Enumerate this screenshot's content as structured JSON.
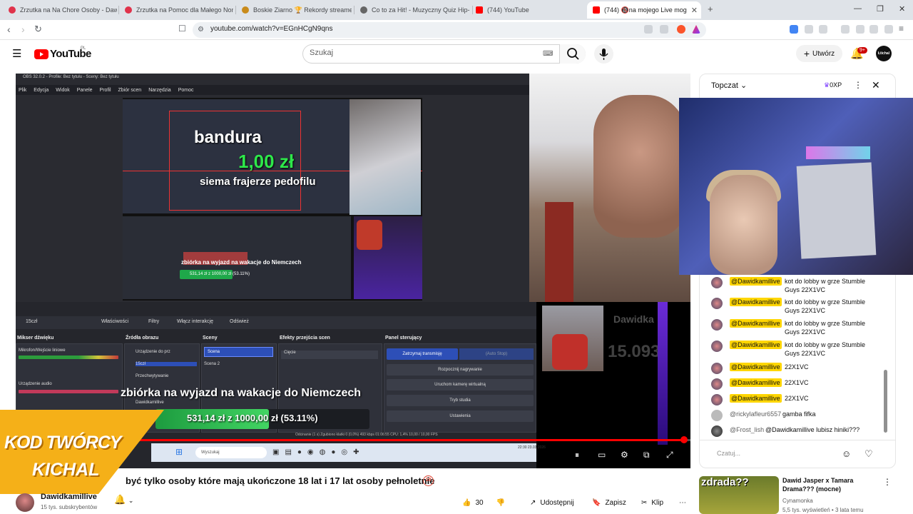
{
  "browser": {
    "tabs": [
      {
        "label": "Zrzutka na Na Chore Osoby - Dawid",
        "color": "#e0334b"
      },
      {
        "label": "Zrzutka na Pomoc dla Małego Nonik",
        "color": "#e0334b"
      },
      {
        "label": "Boskie Ziarno 🏆 Rekordy streamer",
        "color": "#c98b1b"
      },
      {
        "label": "Co to za Hit! - Muzyczny Quiz Hip-H",
        "color": "#666666"
      },
      {
        "label": "(744) YouTube",
        "color": "#ff0000"
      },
      {
        "label": "(744) 🔞na mojego Live mog",
        "color": "#ff0000"
      }
    ],
    "url": "youtube.com/watch?v=EGnHCgN9qns"
  },
  "header": {
    "logo": "YouTube",
    "logo_country": "PL",
    "search_placeholder": "Szukaj",
    "create_label": "Utwórz",
    "notif_count": "9+",
    "avatar_text": "Łtichal"
  },
  "player": {
    "obs_title": "OBS 32.0.2 - Profile: Bez tytułu - Sceny: Bez tytułu",
    "obs_menu": [
      "Plik",
      "Edycja",
      "Widok",
      "Panele",
      "Profil",
      "Zbiór scen",
      "Narzędzia",
      "Pomoc"
    ],
    "bandura": "bandura",
    "amount": "1,00 zł",
    "donation_msg": "siema frajerze pedofilu",
    "mini_msg": "zbiórka na wyjazd na wakacje do Niemczech",
    "mini_progress": "531,14 zł z 1000,00 zł (53.11%)",
    "obs_toolbar": [
      "15czł",
      "Właściwości",
      "Filtry",
      "Włącz interakcję",
      "Odśwież"
    ],
    "docks": [
      "Mikser dźwięku",
      "Źródła obrazu",
      "Sceny",
      "Efekty przejścia scen",
      "Panel sterujący"
    ],
    "mixer_items": [
      "Mikrofon/Wejście liniowe",
      "Urządzenie audio"
    ],
    "sources": [
      "Urządzenie do prz",
      "15czł",
      "Przechwytywanie",
      "Dawidkamillive"
    ],
    "scenes": [
      "Scena",
      "Scena 2"
    ],
    "transition": "Cięcie",
    "controls": [
      "Zatrzymaj transmisję",
      "Rozpocznij nagrywanie",
      "Uruchom kamerę wirtualną",
      "Tryb studia",
      "Ustawienia"
    ],
    "auto_stop": "(Auto Stop)",
    "alert_text": "zbiórka na wyjazd na wakacje do Niemczech",
    "progress_label": "531,14 zł z 1000,00 zł (53.11%)",
    "progress_percent": 53.11,
    "status": "Odcinanie (1 s)   Zgubiono klatki 0 (0,0%)   493 kbps   01:06:55   CPU: 1,4%   10,00 / 10,00 FPS",
    "taskbar_search": "Wyszukaj",
    "clock": "22:30 23.03.2026",
    "brand": "Dawidka",
    "brand_num": "15.093",
    "seek_fraction": 0.99,
    "kod_line1": "KOD TWÓRCY",
    "kod_line2": "KICHAL"
  },
  "video": {
    "title": "być tylko osoby które mają ukończone 18 lat i 17 lat osoby pełnoletnie",
    "title_badge": "18",
    "channel": "Dawidkamillive",
    "subs": "15 tys. subskrybentów",
    "likes": "30",
    "share": "Udostępnij",
    "save": "Zapisz",
    "clip": "Klip"
  },
  "chat": {
    "mode": "Topczat",
    "xp": "0XP",
    "input_placeholder": "Czatuj...",
    "messages": [
      {
        "author": "@Dawidkamillive",
        "text": "kot do lobby w grze Stumble Guys 22X1VC",
        "highlight": true
      },
      {
        "author": "@Dawidkamillive",
        "text": "kot do lobby w grze Stumble Guys 22X1VC",
        "highlight": true
      },
      {
        "author": "@Dawidkamillive",
        "text": "kot do lobby w grze Stumble Guys 22X1VC",
        "highlight": true
      },
      {
        "author": "@Dawidkamillive",
        "text": "kot do lobby w grze Stumble Guys 22X1VC",
        "highlight": true
      },
      {
        "author": "@Dawidkamillive",
        "text": "22X1VC",
        "highlight": true
      },
      {
        "author": "@Dawidkamillive",
        "text": "22X1VC",
        "highlight": true
      },
      {
        "author": "@Dawidkamillive",
        "text": "22X1VC",
        "highlight": true
      },
      {
        "author": "@rickylafleur6557",
        "text": "gamba fifka",
        "highlight": false
      },
      {
        "author": "@Frost_lish",
        "text": "@Dawidkamillive lubisz hiniki???",
        "highlight": false
      }
    ]
  },
  "recommendation": {
    "thumb_text": "zdrada??",
    "title": "Dawid Jasper x Tamara Drama??? (mocne)",
    "channel": "Cynamonka",
    "meta": "5,5 tys. wyświetleń • 3 lata temu"
  }
}
